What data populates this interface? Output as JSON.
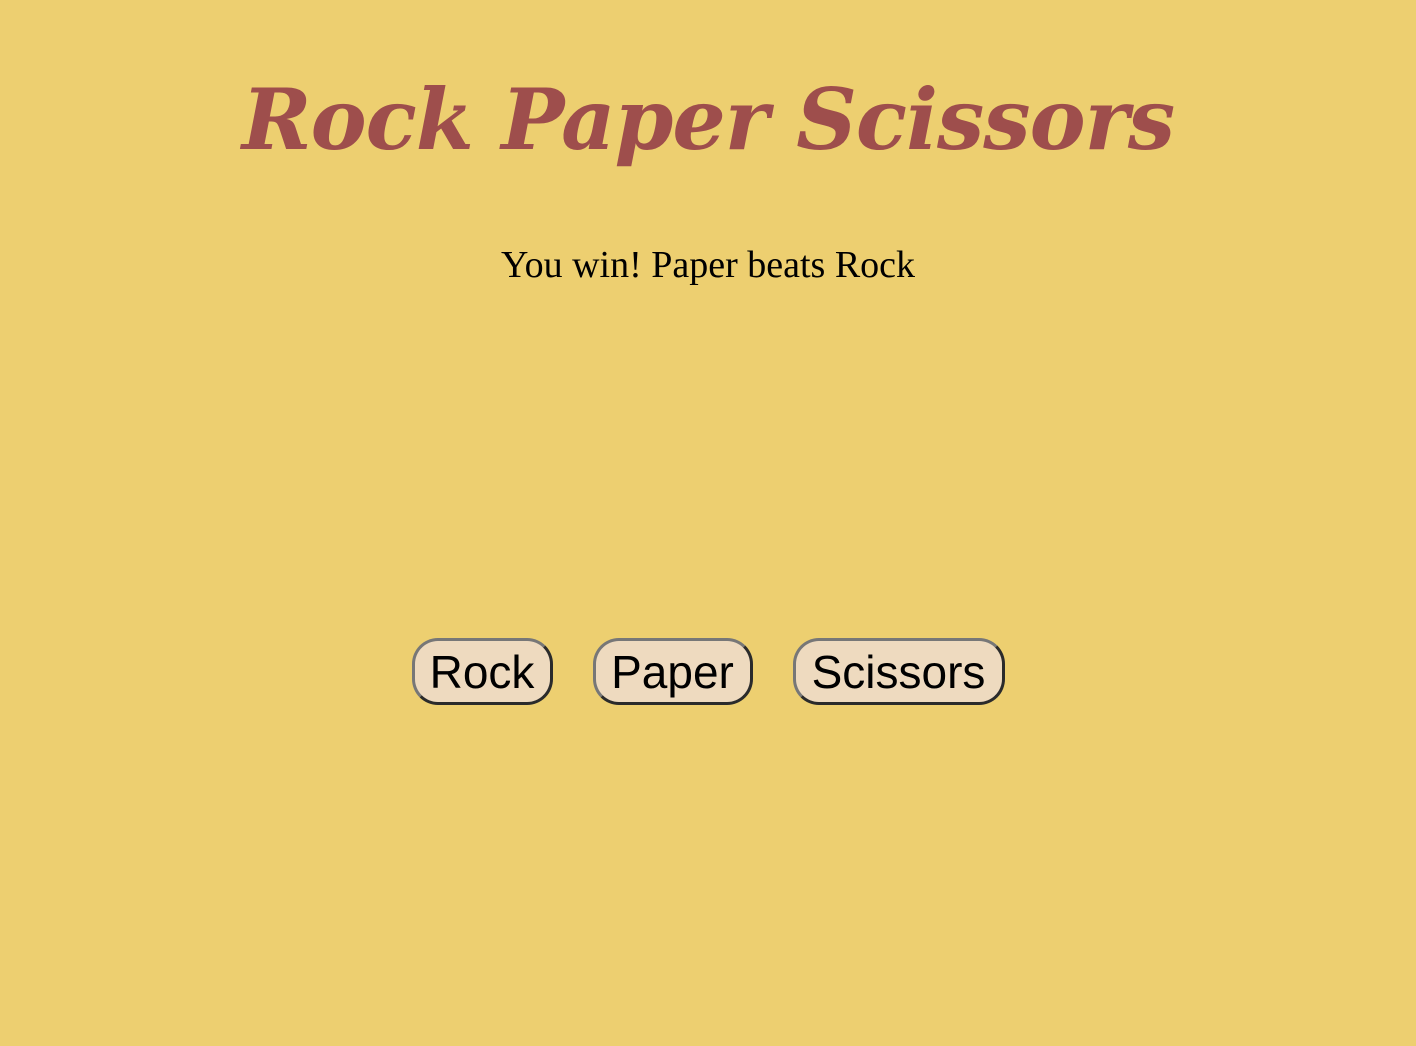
{
  "title": "Rock Paper Scissors",
  "result_text": "You win! Paper beats Rock",
  "choices": {
    "rock": "Rock",
    "paper": "Paper",
    "scissors": "Scissors"
  },
  "colors": {
    "background": "#EDCF70",
    "title": "#9E4E4C",
    "button_face": "#EEDABF"
  }
}
